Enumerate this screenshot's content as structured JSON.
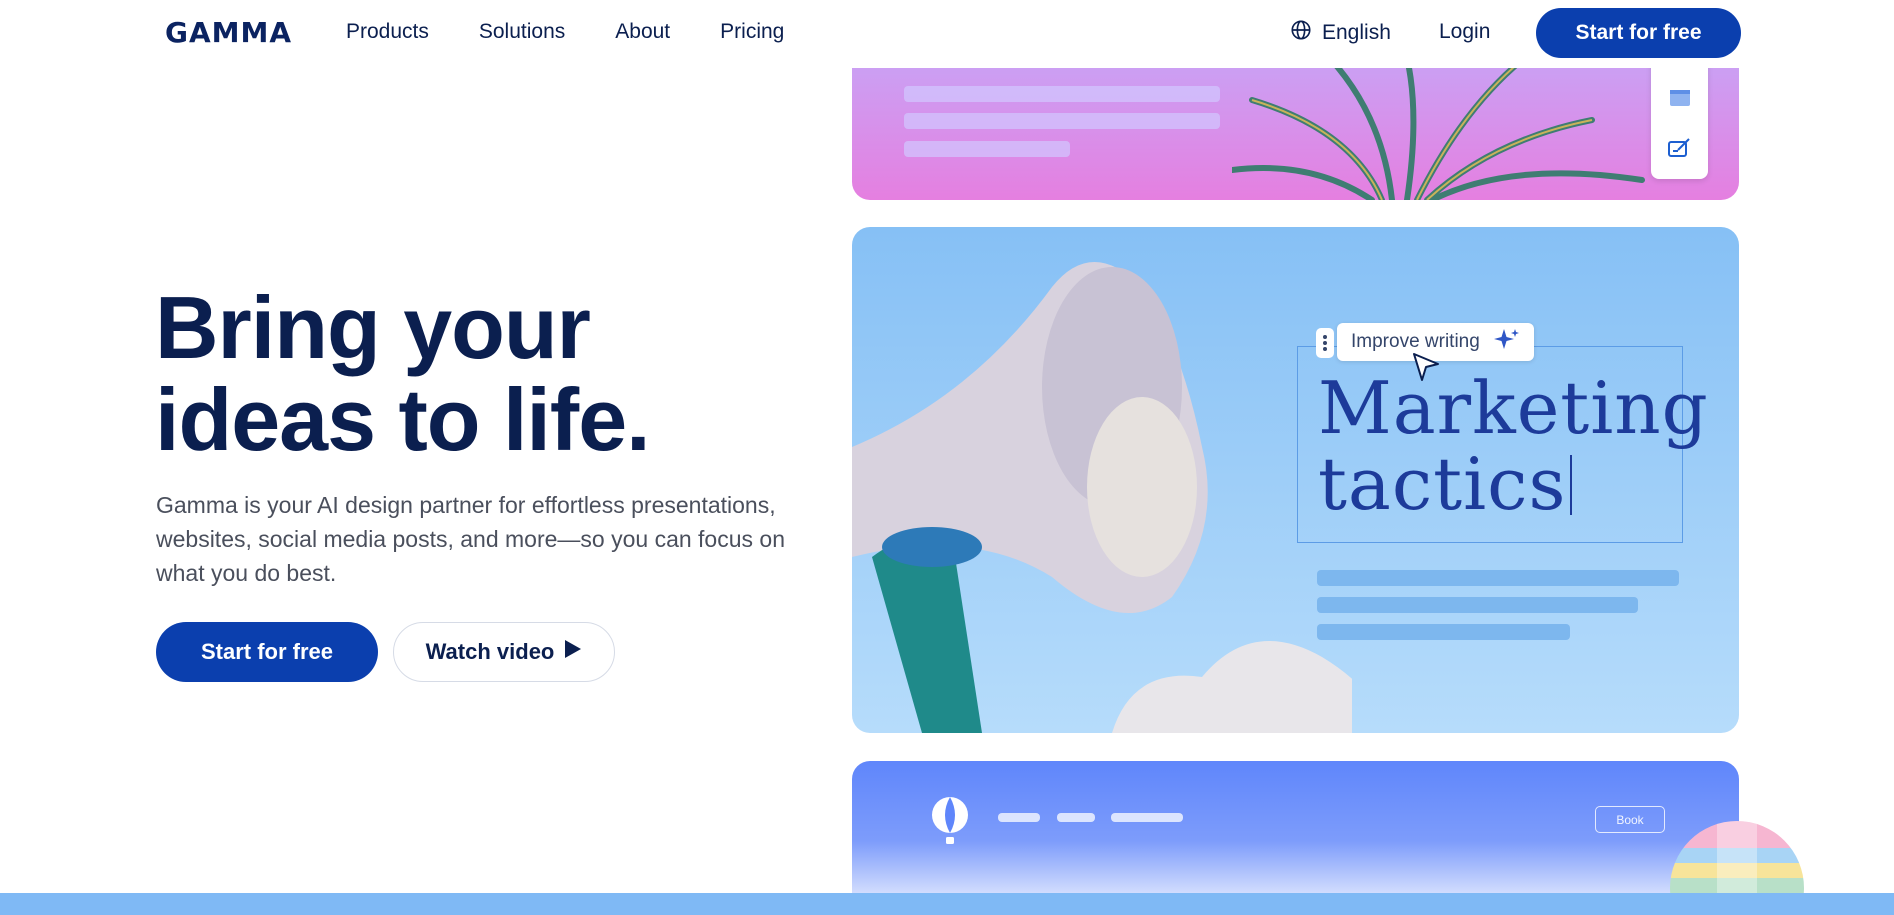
{
  "nav": {
    "logo": "GAMMA",
    "links": [
      "Products",
      "Solutions",
      "About",
      "Pricing"
    ],
    "language": "English",
    "login": "Login",
    "cta": "Start for free"
  },
  "hero": {
    "title_line1": "Bring your",
    "title_line2": "ideas to life.",
    "subtitle": "Gamma is your AI design partner for effortless presentations, websites, social media posts, and more—so you can focus on what you do best.",
    "primary_cta": "Start for free",
    "secondary_cta": "Watch video"
  },
  "preview": {
    "improve_label": "Improve writing",
    "heading_line1": "Marketing",
    "heading_line2": "tactics",
    "book_button": "Book"
  },
  "colors": {
    "brand": "#0b3fae",
    "text": "#0b1f4f",
    "footer_band": "#7fb9f5"
  },
  "icons": {
    "language": "globe-icon",
    "play": "play-icon",
    "sparkle": "sparkle-icon",
    "cursor": "cursor-arrow-icon",
    "card": "card-layout-icon",
    "edit": "edit-icon",
    "balloon": "hot-air-balloon-icon"
  }
}
